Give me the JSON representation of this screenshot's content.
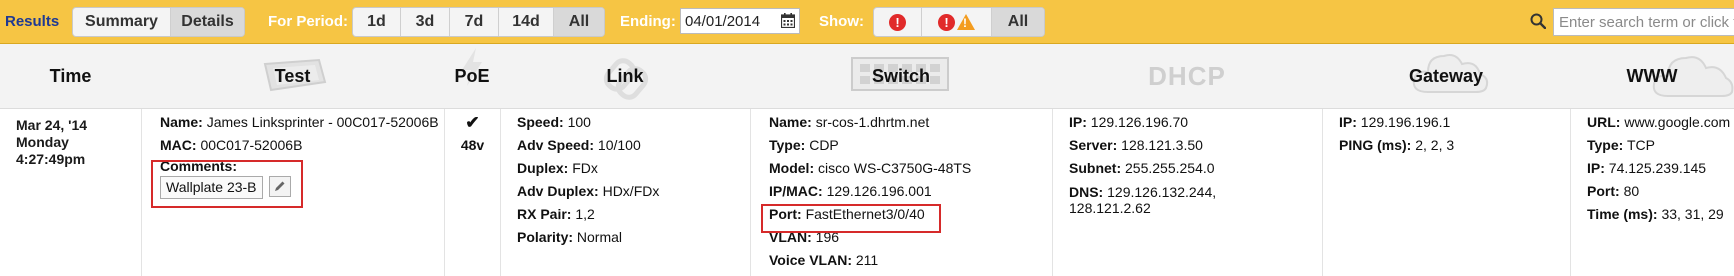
{
  "toolbar": {
    "results_label": "Results",
    "view_tabs": [
      {
        "label": "Summary",
        "selected": false
      },
      {
        "label": "Details",
        "selected": true
      }
    ],
    "period_label": "For Period:",
    "period_options": [
      {
        "label": "1d",
        "selected": false
      },
      {
        "label": "3d",
        "selected": false
      },
      {
        "label": "7d",
        "selected": false
      },
      {
        "label": "14d",
        "selected": false
      },
      {
        "label": "All",
        "selected": true
      }
    ],
    "ending_label": "Ending:",
    "ending_value": "04/01/2014",
    "show_label": "Show:",
    "show_all_label": "All",
    "search_placeholder": "Enter search term or click t"
  },
  "columns": {
    "time": "Time",
    "test": "Test",
    "poe": "PoE",
    "link": "Link",
    "switch": "Switch",
    "dhcp": "DHCP",
    "gateway": "Gateway",
    "www": "WWW"
  },
  "row": {
    "time": {
      "date": "Mar 24, '14",
      "day": "Monday",
      "clock": "4:27:49pm"
    },
    "test": {
      "name_key": "Name:",
      "name_val": "James Linksprinter - 00C017-52006B",
      "mac_key": "MAC:",
      "mac_val": "00C017-52006B",
      "comments_key": "Comments:",
      "comments_val": "Wallplate 23-B"
    },
    "poe": {
      "check": "✔",
      "voltage": "48v"
    },
    "link": [
      {
        "k": "Speed:",
        "v": "100"
      },
      {
        "k": "Adv Speed:",
        "v": "10/100"
      },
      {
        "k": "Duplex:",
        "v": "FDx"
      },
      {
        "k": "Adv Duplex:",
        "v": "HDx/FDx"
      },
      {
        "k": "RX Pair:",
        "v": "1,2"
      },
      {
        "k": "Polarity:",
        "v": "Normal"
      }
    ],
    "switch": [
      {
        "k": "Name:",
        "v": "sr-cos-1.dhrtm.net"
      },
      {
        "k": "Type:",
        "v": "CDP"
      },
      {
        "k": "Model:",
        "v": "cisco WS-C3750G-48TS"
      },
      {
        "k": "IP/MAC:",
        "v": "129.126.196.001"
      },
      {
        "k": "Port:",
        "v": "FastEthernet3/0/40"
      },
      {
        "k": "VLAN:",
        "v": "196"
      },
      {
        "k": "Voice VLAN:",
        "v": "211"
      }
    ],
    "dhcp": [
      {
        "k": "IP:",
        "v": "129.126.196.70"
      },
      {
        "k": "Server:",
        "v": "128.121.3.50"
      },
      {
        "k": "Subnet:",
        "v": "255.255.254.0"
      },
      {
        "k": "DNS:",
        "v": "129.126.132.244,"
      },
      {
        "k": "",
        "v": "128.121.2.62"
      }
    ],
    "gateway": [
      {
        "k": "IP:",
        "v": "129.196.196.1"
      },
      {
        "k": "PING (ms):",
        "v": "2, 2, 3"
      }
    ],
    "www": [
      {
        "k": "URL:",
        "v": "www.google.com"
      },
      {
        "k": "Type:",
        "v": "TCP"
      },
      {
        "k": "IP:",
        "v": "74.125.239.145"
      },
      {
        "k": "Port:",
        "v": "80"
      },
      {
        "k": "Time (ms):",
        "v": "33, 31, 29"
      }
    ]
  },
  "colors": {
    "toolbar": "#f6c544",
    "highlight": "#d62a2a",
    "alert": "#e12a2a",
    "warning": "#f39c1f"
  }
}
